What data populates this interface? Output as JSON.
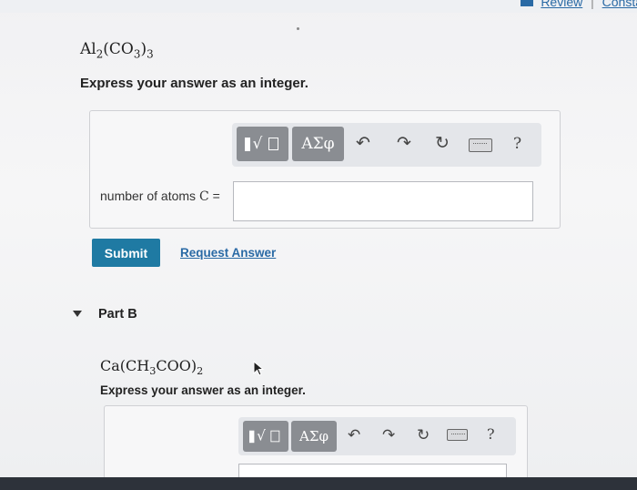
{
  "header": {
    "links": [
      "Review",
      "Consta"
    ],
    "separator": "|"
  },
  "partA": {
    "formula": {
      "base1": "Al",
      "sub1": "2",
      "base2": "(CO",
      "sub2": "3",
      "base3": ")",
      "sub3": "3"
    },
    "prompt": "Express your answer as an integer.",
    "toolbar": {
      "template_icon": "template-radical-icon",
      "greek_label": "ΑΣφ",
      "undo_icon": "undo-icon",
      "redo_icon": "redo-icon",
      "reset_icon": "reset-icon",
      "keyboard_icon": "keyboard-icon",
      "help_label": "?"
    },
    "field_label": "number of atoms",
    "field_var": "C",
    "field_eq": "=",
    "answer_value": "",
    "submit_label": "Submit",
    "request_label": "Request Answer"
  },
  "partB": {
    "title": "Part B",
    "formula": {
      "base1": "Ca(CH",
      "sub1": "3",
      "base2": "COO)",
      "sub2": "2"
    },
    "prompt": "Express your answer as an integer.",
    "toolbar": {
      "greek_label": "ΑΣφ",
      "help_label": "?"
    }
  },
  "colors": {
    "accent": "#1f7aa3",
    "link": "#2a6aa5",
    "toolbar_button": "#8a8d92",
    "background": "#f1f1f3"
  }
}
